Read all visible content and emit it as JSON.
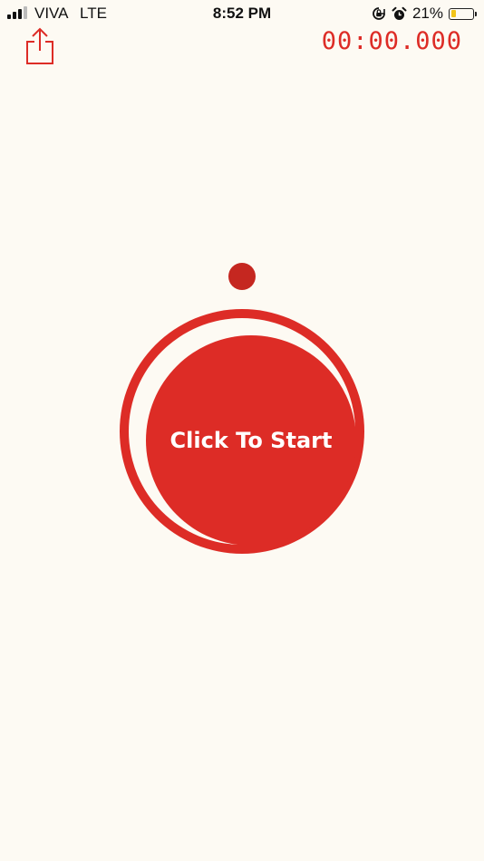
{
  "status_bar": {
    "carrier": "VIVA",
    "network": "LTE",
    "time": "8:52 PM",
    "battery_percent": "21%",
    "battery_level": 0.21,
    "icons": [
      "signal-icon",
      "orientation-lock-icon",
      "alarm-icon",
      "battery-icon"
    ],
    "signal_bars_active": 3,
    "signal_bars_total": 4
  },
  "toolbar": {
    "share_icon": "share-icon",
    "timer": "00:00.000"
  },
  "start_button": {
    "label": "Click To Start"
  },
  "colors": {
    "background": "#fdfaf3",
    "accent": "#dd2c26",
    "dot": "#c52720",
    "battery": "#f2c418",
    "text": "#111111"
  }
}
